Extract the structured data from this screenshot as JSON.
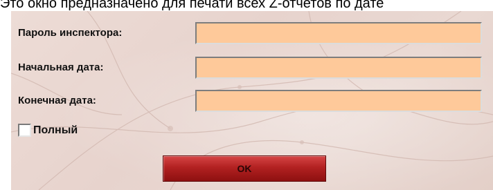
{
  "caption": "Это окно предназначено для печати всех Z-отчетов по дате",
  "form": {
    "password_label": "Пароль инспектора:",
    "password_value": "",
    "start_date_label": "Начальная дата:",
    "start_date_value": "",
    "end_date_label": "Конечная дата:",
    "end_date_value": "",
    "full_label": "Полный",
    "full_checked": false,
    "ok_label": "OK"
  },
  "colors": {
    "field_bg": "#fec99a",
    "button_bg": "#b22121",
    "panel_bg": "#e9d8d2"
  }
}
